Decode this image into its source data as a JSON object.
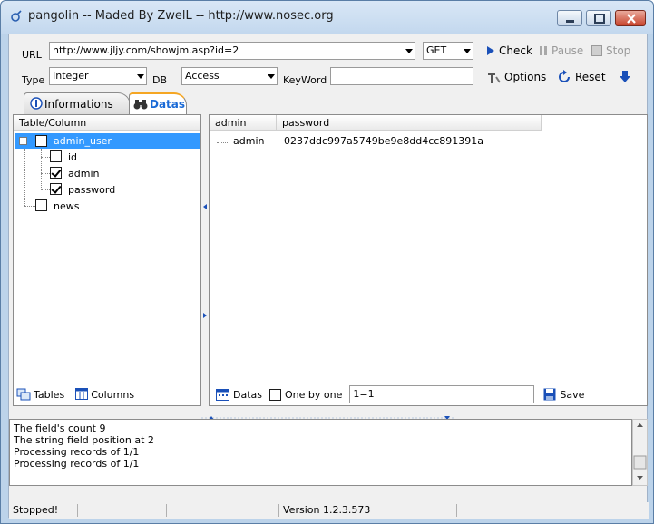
{
  "window": {
    "title": "pangolin -- Maded By ZwelL -- http://www.nosec.org"
  },
  "toolbar": {
    "url_label": "URL",
    "url_value": "http://www.jljy.com/showjm.asp?id=2",
    "method_value": "GET",
    "check_label": "Check",
    "pause_label": "Pause",
    "stop_label": "Stop",
    "type_label": "Type",
    "type_value": "Integer",
    "db_label": "DB",
    "db_value": "Access",
    "keyword_label": "KeyWord",
    "keyword_value": "",
    "options_label": "Options",
    "reset_label": "Reset"
  },
  "tabs": [
    {
      "label": "Informations",
      "icon": "info-icon"
    },
    {
      "label": "Datas",
      "icon": "binoculars-icon"
    }
  ],
  "tree": {
    "header": "Table/Column",
    "nodes": [
      {
        "label": "admin_user",
        "checked": false,
        "selected": true,
        "children": [
          {
            "label": "id",
            "checked": false
          },
          {
            "label": "admin",
            "checked": true
          },
          {
            "label": "password",
            "checked": true
          }
        ]
      },
      {
        "label": "news",
        "checked": false
      }
    ],
    "tables_label": "Tables",
    "columns_label": "Columns"
  },
  "grid": {
    "columns": [
      "admin",
      "password"
    ],
    "rows": [
      [
        "admin",
        "0237ddc997a5749be9e8dd4cc891391a"
      ]
    ],
    "datas_label": "Datas",
    "one_by_one_label": "One by one",
    "condition_value": "1=1",
    "save_label": "Save"
  },
  "log": {
    "lines": [
      "The field's count 9",
      "The string field position at 2",
      "Processing records of 1/1",
      "Processing records of 1/1"
    ]
  },
  "status": {
    "state": "Stopped!",
    "version": "Version  1.2.3.573"
  },
  "colors": {
    "accent": "#1a6ad6",
    "tab_highlight": "#f5a623",
    "selection": "#3399ff"
  }
}
